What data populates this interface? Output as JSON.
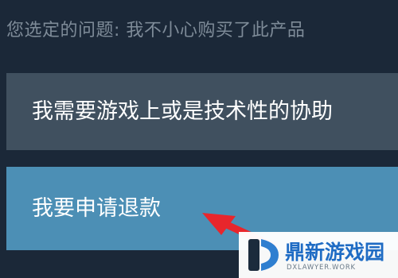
{
  "header": {
    "selected_issue_text": "您选定的问题: 我不小心购买了此产品"
  },
  "options": [
    {
      "label": "我需要游戏上或是技术性的协助"
    },
    {
      "label": "我要申请退款"
    }
  ],
  "annotation": {
    "arrow_color": "#e8262c"
  },
  "watermark": {
    "title": "鼎新游戏园",
    "subtitle": "DXLAWYER.WORK"
  },
  "colors": {
    "background": "#1b2838",
    "option_default": "#40505f",
    "option_highlight": "#4c8fb5",
    "watermark_brand": "#1f6cc4"
  }
}
